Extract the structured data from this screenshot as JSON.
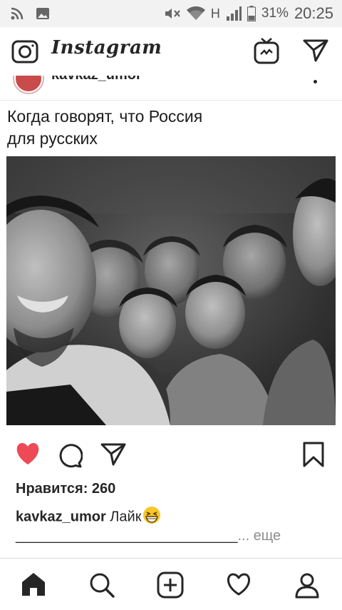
{
  "status_bar": {
    "network": "H",
    "battery": "31%",
    "time": "20:25"
  },
  "app": {
    "title": "Instagram"
  },
  "post": {
    "username": "kavkaz_umor",
    "caption_line1": "Когда говорят, что Россия",
    "caption_line2": "для русских",
    "likes": "Нравится: 260",
    "comment_user": "kavkaz_umor",
    "comment_text": " Лайк",
    "more_line": "____________________________",
    "more_link": "... еще",
    "liked": true
  },
  "colors": {
    "like_red": "#ed4956",
    "text": "#262626",
    "muted": "#8e8e8e"
  },
  "icons": [
    "camera-icon",
    "igtv-icon",
    "direct-message-icon",
    "heart-icon",
    "comment-icon",
    "share-icon",
    "bookmark-icon",
    "home-icon",
    "search-icon",
    "add-post-icon",
    "activity-icon",
    "profile-icon"
  ]
}
